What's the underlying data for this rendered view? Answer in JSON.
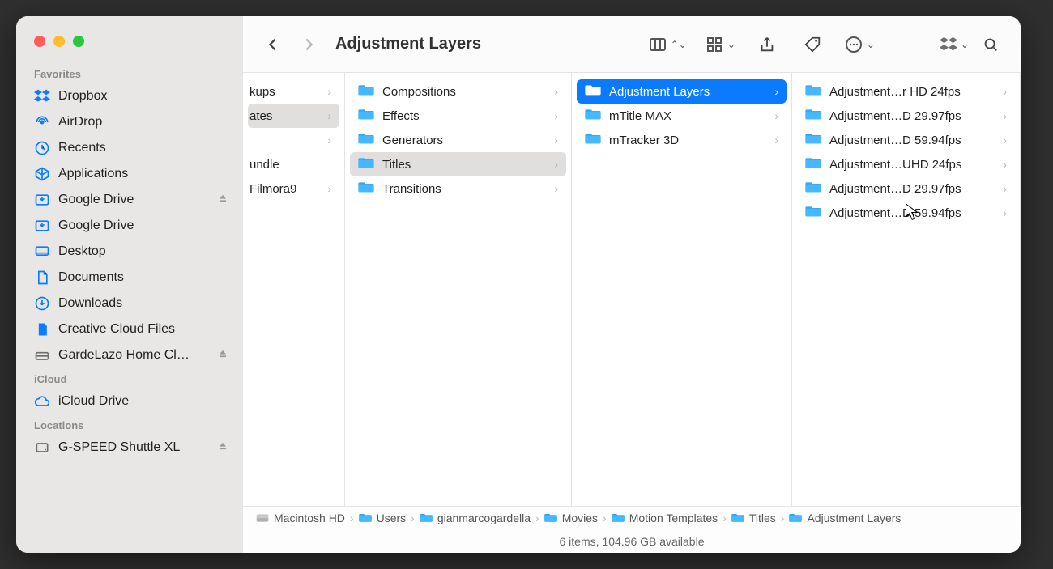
{
  "window_title": "Adjustment Layers",
  "sidebar": {
    "sections": [
      {
        "title": "Favorites",
        "items": [
          {
            "label": "Dropbox",
            "icon": "dropbox",
            "eject": false
          },
          {
            "label": "AirDrop",
            "icon": "airdrop",
            "eject": false
          },
          {
            "label": "Recents",
            "icon": "clock",
            "eject": false
          },
          {
            "label": "Applications",
            "icon": "apps",
            "eject": false
          },
          {
            "label": "Google Drive",
            "icon": "gdrive",
            "eject": true
          },
          {
            "label": "Google Drive",
            "icon": "gdrive",
            "eject": false
          },
          {
            "label": "Desktop",
            "icon": "desktop",
            "eject": false
          },
          {
            "label": "Documents",
            "icon": "doc",
            "eject": false
          },
          {
            "label": "Downloads",
            "icon": "download",
            "eject": false
          },
          {
            "label": "Creative Cloud Files",
            "icon": "file",
            "eject": false
          },
          {
            "label": "GardeLazo Home Cl…",
            "icon": "drive",
            "eject": true
          }
        ]
      },
      {
        "title": "iCloud",
        "items": [
          {
            "label": "iCloud Drive",
            "icon": "cloud",
            "eject": false
          }
        ]
      },
      {
        "title": "Locations",
        "items": [
          {
            "label": "G-SPEED Shuttle XL",
            "icon": "hdd",
            "eject": true
          }
        ]
      }
    ]
  },
  "columns": [
    {
      "items": [
        {
          "label": "kups",
          "has_children": true,
          "selected": false
        },
        {
          "label": "ates",
          "has_children": true,
          "selected": true
        },
        {
          "label": "",
          "has_children": true,
          "selected": false
        },
        {
          "label": "undle",
          "has_children": false,
          "selected": false
        },
        {
          "label": "Filmora9",
          "has_children": true,
          "selected": false
        }
      ]
    },
    {
      "items": [
        {
          "label": "Compositions",
          "has_children": true,
          "selected": false
        },
        {
          "label": "Effects",
          "has_children": true,
          "selected": false
        },
        {
          "label": "Generators",
          "has_children": true,
          "selected": false
        },
        {
          "label": "Titles",
          "has_children": true,
          "selected": true
        },
        {
          "label": "Transitions",
          "has_children": true,
          "selected": false
        }
      ]
    },
    {
      "items": [
        {
          "label": "Adjustment Layers",
          "has_children": true,
          "selected": true
        },
        {
          "label": "mTitle MAX",
          "has_children": true,
          "selected": false
        },
        {
          "label": "mTracker 3D",
          "has_children": true,
          "selected": false
        }
      ]
    },
    {
      "items": [
        {
          "label": "Adjustment…r HD 24fps",
          "has_children": true,
          "selected": false
        },
        {
          "label": "Adjustment…D 29.97fps",
          "has_children": true,
          "selected": false
        },
        {
          "label": "Adjustment…D 59.94fps",
          "has_children": true,
          "selected": false
        },
        {
          "label": "Adjustment…UHD 24fps",
          "has_children": true,
          "selected": false
        },
        {
          "label": "Adjustment…D 29.97fps",
          "has_children": true,
          "selected": false
        },
        {
          "label": "Adjustment…D 59.94fps",
          "has_children": true,
          "selected": false
        }
      ]
    }
  ],
  "pathbar": [
    {
      "label": "Macintosh HD",
      "icon": "drive"
    },
    {
      "label": "Users",
      "icon": "folder"
    },
    {
      "label": "gianmarcogardella",
      "icon": "folder"
    },
    {
      "label": "Movies",
      "icon": "folder"
    },
    {
      "label": "Motion Templates",
      "icon": "folder"
    },
    {
      "label": "Titles",
      "icon": "folder"
    },
    {
      "label": "Adjustment Layers",
      "icon": "folder"
    }
  ],
  "status": "6 items, 104.96 GB available"
}
